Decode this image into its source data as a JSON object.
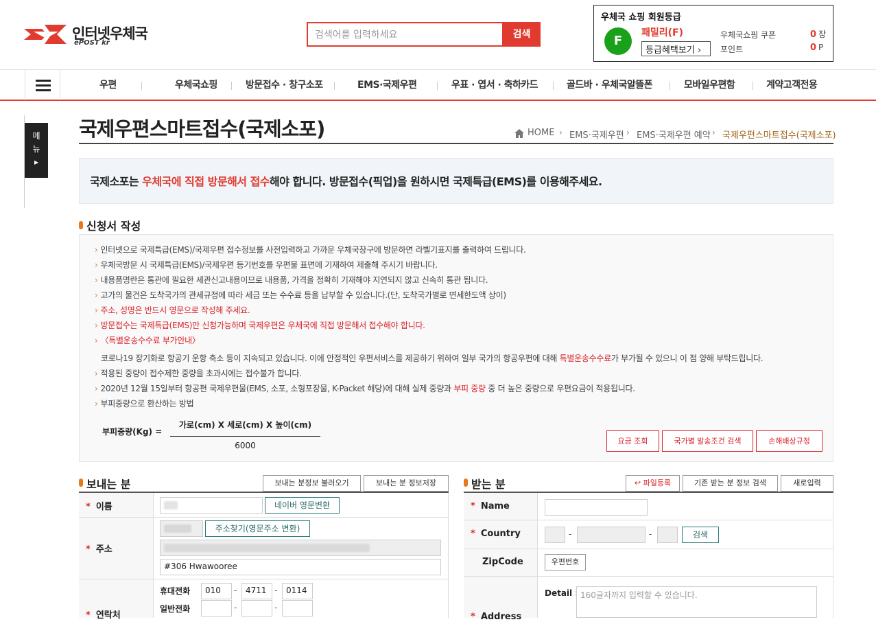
{
  "header": {
    "logo_text": "인터넷우체국",
    "logo_sub": "ePOST kr",
    "search_placeholder": "검색어를 입력하세요",
    "search_button": "검색"
  },
  "member": {
    "title": "우체국 쇼핑 회원등급",
    "grade_letter": "F",
    "grade_name": "패밀리(F)",
    "benefit_button": "등급혜택보기",
    "coupon_label": "우체국쇼핑 쿠폰",
    "coupon_value": "0",
    "coupon_unit": "장",
    "point_label": "포인트",
    "point_value": "0",
    "point_unit": "P"
  },
  "nav": [
    "우편",
    "우체국쇼핑",
    "방문접수 · 창구소포",
    "EMS·국제우편",
    "우표 · 엽서 · 축하카드",
    "골드바 · 우체국알뜰폰",
    "모바일우편함",
    "계약고객전용"
  ],
  "side_menu": [
    "메",
    "뉴",
    "▸"
  ],
  "page_title": "국제우편스마트접수(국제소포)",
  "breadcrumb": [
    "HOME",
    "EMS·국제우편",
    "EMS·국제우편 예약",
    "국제우편스마트접수(국제소포)"
  ],
  "notice": {
    "part1": "국제소포는 ",
    "red": "우체국에 직접 방문해서 접수",
    "part2": "해야 합니다. 방문접수(픽업)을 원하시면 국제특급(EMS)를 이용해주세요."
  },
  "guide": {
    "title": "신청서 작성",
    "l1": "인터넷으로 국제특급(EMS)/국제우편 접수정보를 사전입력하고 가까운 우체국창구에 방문하면 라벨기표지를 출력하여 드립니다.",
    "l2": "우체국방문 시 국제특급(EMS)/국제우편 등기번호를 우편물 표면에 기재하여 제출해 주시기 바랍니다.",
    "l3": "내용품명란은 통관에 필요한 세관신고내용이므로 내용품, 가격을 정확히 기재해야 지연되지 않고 신속히 통관 됩니다.",
    "l4": "고가의 물건은 도착국가의 관세규정에 따라 세금 또는 수수료 등을 납부할 수 있습니다.(단, 도착국가별로 면세한도액 상이)",
    "l5": "주소, 성명은 반드시 영문으로 작성해 주세요.",
    "l6": "방문접수는 국제특급(EMS)만 신청가능하며 국제우편은 우체국에 직접 방문해서 접수해야 합니다.",
    "l7": "〈특별운송수수료 부가안내〉",
    "l8a": "코로나19 장기화로 항공기 운항 축소 등이 지속되고 있습니다. 이에 안정적인 우편서비스를 제공하기 위하여 일부 국가의 항공우편에 대해 ",
    "l8b": "특별운송수수료",
    "l8c": "가 부가될 수 있으니 이 점 양해 부탁드립니다.",
    "l9": "적용된 중량이 접수제한 중량을 초과시에는 접수불가 합니다.",
    "l10a": "2020년 12월 15일부터 항공편 국제우편물(EMS, 소포, 소형포장물, K-Packet 해당)에 대해 실제 중량과 ",
    "l10b": "부피 중량",
    "l10c": " 중 더 높은 중량으로 우편요금이 적용됩니다.",
    "l11": "부피중량으로 환산하는 방법",
    "formula_label": "부피중량(Kg) =",
    "formula_num": "가로(cm) X 세로(cm) X 높이(cm)",
    "formula_den": "6000",
    "btn_rate": "요금 조회",
    "btn_country": "국가별 발송조건 검색",
    "btn_damage": "손해배상규정"
  },
  "sender": {
    "title": "보내는 분",
    "btn_load": "보내는 분정보 불러오기",
    "btn_save": "보내는 분 정보저장",
    "name_label": "이름",
    "btn_naver": "네이버 영문변환",
    "addr_label": "주소",
    "btn_addr": "주소찾기(영문주소 변환)",
    "addr_detail": "#306 Hwawooree",
    "contact_label": "연락처",
    "mobile_label": "휴대전화",
    "mobile1": "010",
    "mobile2": "4711",
    "mobile3": "0114",
    "phone_label": "일반전화"
  },
  "receiver": {
    "title": "받는 분",
    "btn_file": "파일등록",
    "btn_search": "기존 받는 분 정보 검색",
    "btn_new": "새로입력",
    "name_label": "Name",
    "country_label": "Country",
    "btn_country_search": "검색",
    "zip_label": "ZipCode",
    "zip_btn": "우편번호",
    "detail_label": "Detail :",
    "detail_placeholder": "160글자까지 입력할 수 있습니다.",
    "address_label": "Address"
  }
}
